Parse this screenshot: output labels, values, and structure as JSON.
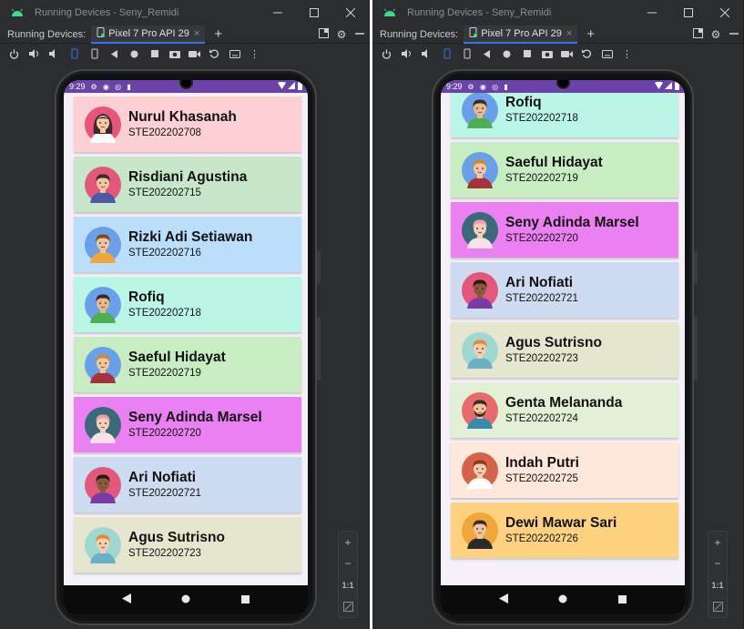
{
  "window": {
    "title": "Running Devices - Seny_Remidi",
    "running_label": "Running Devices:",
    "tab_label": "Pixel 7 Pro API 29",
    "tab_close": "×",
    "add_tab": "+"
  },
  "status": {
    "time": "9:29"
  },
  "zoom": {
    "plus": "+",
    "minus": "−",
    "ratio": "1:1"
  },
  "colors": {
    "status_bar": "#6a42a8",
    "screen_bg": "#f6f0f8",
    "ide_bg": "#2b2d30",
    "tab_accent": "#3574f0"
  },
  "left_list": [
    {
      "name": "Nurul Khasanah",
      "nim": "STE202202708",
      "color": "#fdd0d4",
      "avatar": "female-hijab-avatar"
    },
    {
      "name": "Risdiani Agustina",
      "nim": "STE202202715",
      "color": "#c8e6c9",
      "avatar": "female-bun-avatar"
    },
    {
      "name": "Rizki Adi Setiawan",
      "nim": "STE202202716",
      "color": "#bbdefb",
      "avatar": "male-brown-hair-avatar"
    },
    {
      "name": "Rofiq",
      "nim": "STE202202718",
      "color": "#b9f6e6",
      "avatar": "male-green-shirt-avatar"
    },
    {
      "name": "Saeful Hidayat",
      "nim": "STE202202719",
      "color": "#c8edc3",
      "avatar": "male-blond-avatar"
    },
    {
      "name": "Seny Adinda Marsel",
      "nim": "STE202202720",
      "color": "#ea80f2",
      "avatar": "female-pink-hair-avatar"
    },
    {
      "name": "Ari Nofiati",
      "nim": "STE202202721",
      "color": "#cddcf0",
      "avatar": "female-curly-hair-avatar"
    },
    {
      "name": "Agus Sutrisno",
      "nim": "STE202202723",
      "color": "#e6e5cd",
      "avatar": "female-ginger-avatar"
    }
  ],
  "right_list": [
    {
      "name": "Rofiq",
      "nim": "STE202202718",
      "color": "#b9f6e6",
      "avatar": "male-green-shirt-avatar"
    },
    {
      "name": "Saeful Hidayat",
      "nim": "STE202202719",
      "color": "#c8edc3",
      "avatar": "male-blond-avatar"
    },
    {
      "name": "Seny Adinda Marsel",
      "nim": "STE202202720",
      "color": "#ea80f2",
      "avatar": "female-pink-hair-avatar"
    },
    {
      "name": "Ari Nofiati",
      "nim": "STE202202721",
      "color": "#cddcf0",
      "avatar": "female-curly-hair-avatar"
    },
    {
      "name": "Agus Sutrisno",
      "nim": "STE202202723",
      "color": "#e6e5cd",
      "avatar": "female-ginger-avatar"
    },
    {
      "name": "Genta Melananda",
      "nim": "STE202202724",
      "color": "#e2f1d5",
      "avatar": "male-beard-avatar"
    },
    {
      "name": "Indah Putri",
      "nim": "STE202202725",
      "color": "#fde8da",
      "avatar": "male-red-hair-avatar"
    },
    {
      "name": "Dewi Mawar Sari",
      "nim": "STE202202726",
      "color": "#ffd27f",
      "avatar": "male-dark-hair-avatar"
    }
  ]
}
